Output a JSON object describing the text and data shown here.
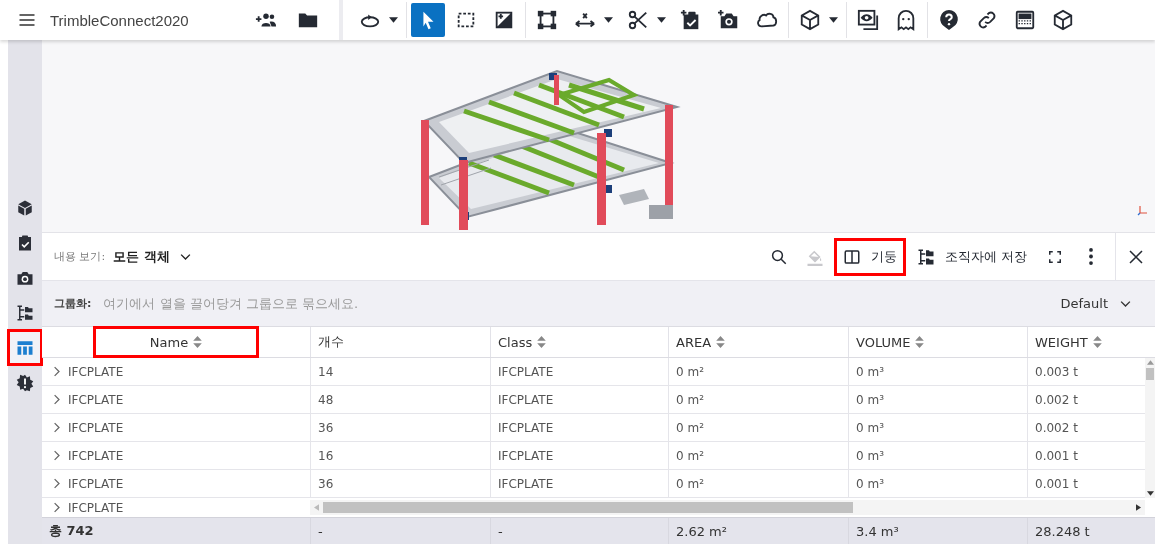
{
  "app_bar": {
    "title": "TrimbleConnect2020",
    "tool_groups": [
      [
        {
          "selected": false,
          "dropdown": false
        },
        {
          "selected": false,
          "dropdown": false
        }
      ],
      [
        {
          "selected": false,
          "dropdown": true
        }
      ],
      [
        {
          "selected": true,
          "dropdown": false
        },
        {
          "selected": false,
          "dropdown": false
        },
        {
          "selected": false,
          "dropdown": false
        }
      ],
      [
        {
          "selected": false,
          "dropdown": false
        },
        {
          "selected": false,
          "dropdown": true
        },
        {
          "selected": false,
          "dropdown": true
        },
        {
          "selected": false,
          "dropdown": false
        },
        {
          "selected": false,
          "dropdown": false
        },
        {
          "selected": false,
          "dropdown": false
        }
      ],
      [
        {
          "selected": false,
          "dropdown": true
        }
      ],
      [
        {
          "selected": false,
          "dropdown": false
        },
        {
          "selected": false,
          "dropdown": false
        }
      ],
      [
        {
          "selected": false,
          "dropdown": false
        },
        {
          "selected": false,
          "dropdown": false
        },
        {
          "selected": false,
          "dropdown": false
        },
        {
          "selected": false,
          "dropdown": false
        }
      ]
    ]
  },
  "sidebar": {
    "items": [
      {
        "selected": false,
        "highlighted": false
      },
      {
        "selected": false,
        "highlighted": false
      },
      {
        "selected": false,
        "highlighted": false
      },
      {
        "selected": false,
        "highlighted": false
      },
      {
        "selected": true,
        "highlighted": true
      },
      {
        "selected": false,
        "highlighted": false
      }
    ]
  },
  "panel": {
    "view_label": "내용 보기:",
    "view_value": "모든 객체",
    "actions": [
      {
        "kind": "search",
        "disabled": false,
        "highlighted": false
      },
      {
        "kind": "paint",
        "disabled": true,
        "highlighted": false
      },
      {
        "kind": "columns",
        "label": "기둥",
        "disabled": false,
        "highlighted": true
      },
      {
        "kind": "organizer",
        "label": "조직자에 저장",
        "disabled": false,
        "highlighted": false
      },
      {
        "kind": "fullscreen",
        "disabled": false,
        "highlighted": false
      },
      {
        "kind": "more",
        "disabled": false,
        "highlighted": false
      },
      {
        "kind": "close",
        "disabled": false,
        "highlighted": false
      }
    ],
    "grouping": {
      "label": "그룹화:",
      "placeholder": "여기에서 열을 끌어당겨 그룹으로 묶으세요.",
      "preset": "Default"
    },
    "table": {
      "columns": [
        {
          "label": "Name",
          "sortable": true,
          "highlighted": true
        },
        {
          "label": "개수",
          "sortable": false,
          "highlighted": false
        },
        {
          "label": "Class",
          "sortable": true,
          "highlighted": false
        },
        {
          "label": "AREA",
          "sortable": true,
          "highlighted": false
        },
        {
          "label": "VOLUME",
          "sortable": true,
          "highlighted": false
        },
        {
          "label": "WEIGHT",
          "sortable": true,
          "highlighted": false
        }
      ],
      "rows": [
        {
          "expanded": false,
          "cells": [
            "IFCPLATE",
            "14",
            "IFCPLATE",
            "0 m²",
            "0 m³",
            "0.003 t"
          ]
        },
        {
          "expanded": false,
          "cells": [
            "IFCPLATE",
            "48",
            "IFCPLATE",
            "0 m²",
            "0 m³",
            "0.002 t"
          ]
        },
        {
          "expanded": false,
          "cells": [
            "IFCPLATE",
            "36",
            "IFCPLATE",
            "0 m²",
            "0 m³",
            "0.002 t"
          ]
        },
        {
          "expanded": false,
          "cells": [
            "IFCPLATE",
            "16",
            "IFCPLATE",
            "0 m²",
            "0 m³",
            "0.001 t"
          ]
        },
        {
          "expanded": false,
          "cells": [
            "IFCPLATE",
            "36",
            "IFCPLATE",
            "0 m²",
            "0 m³",
            "0.001 t"
          ]
        },
        {
          "expanded": false,
          "cells": [
            "IFCPLATE"
          ]
        }
      ],
      "totals": [
        "총 742",
        "-",
        "-",
        "2.62 m²",
        "3.4 m³",
        "28.248 t"
      ]
    }
  }
}
